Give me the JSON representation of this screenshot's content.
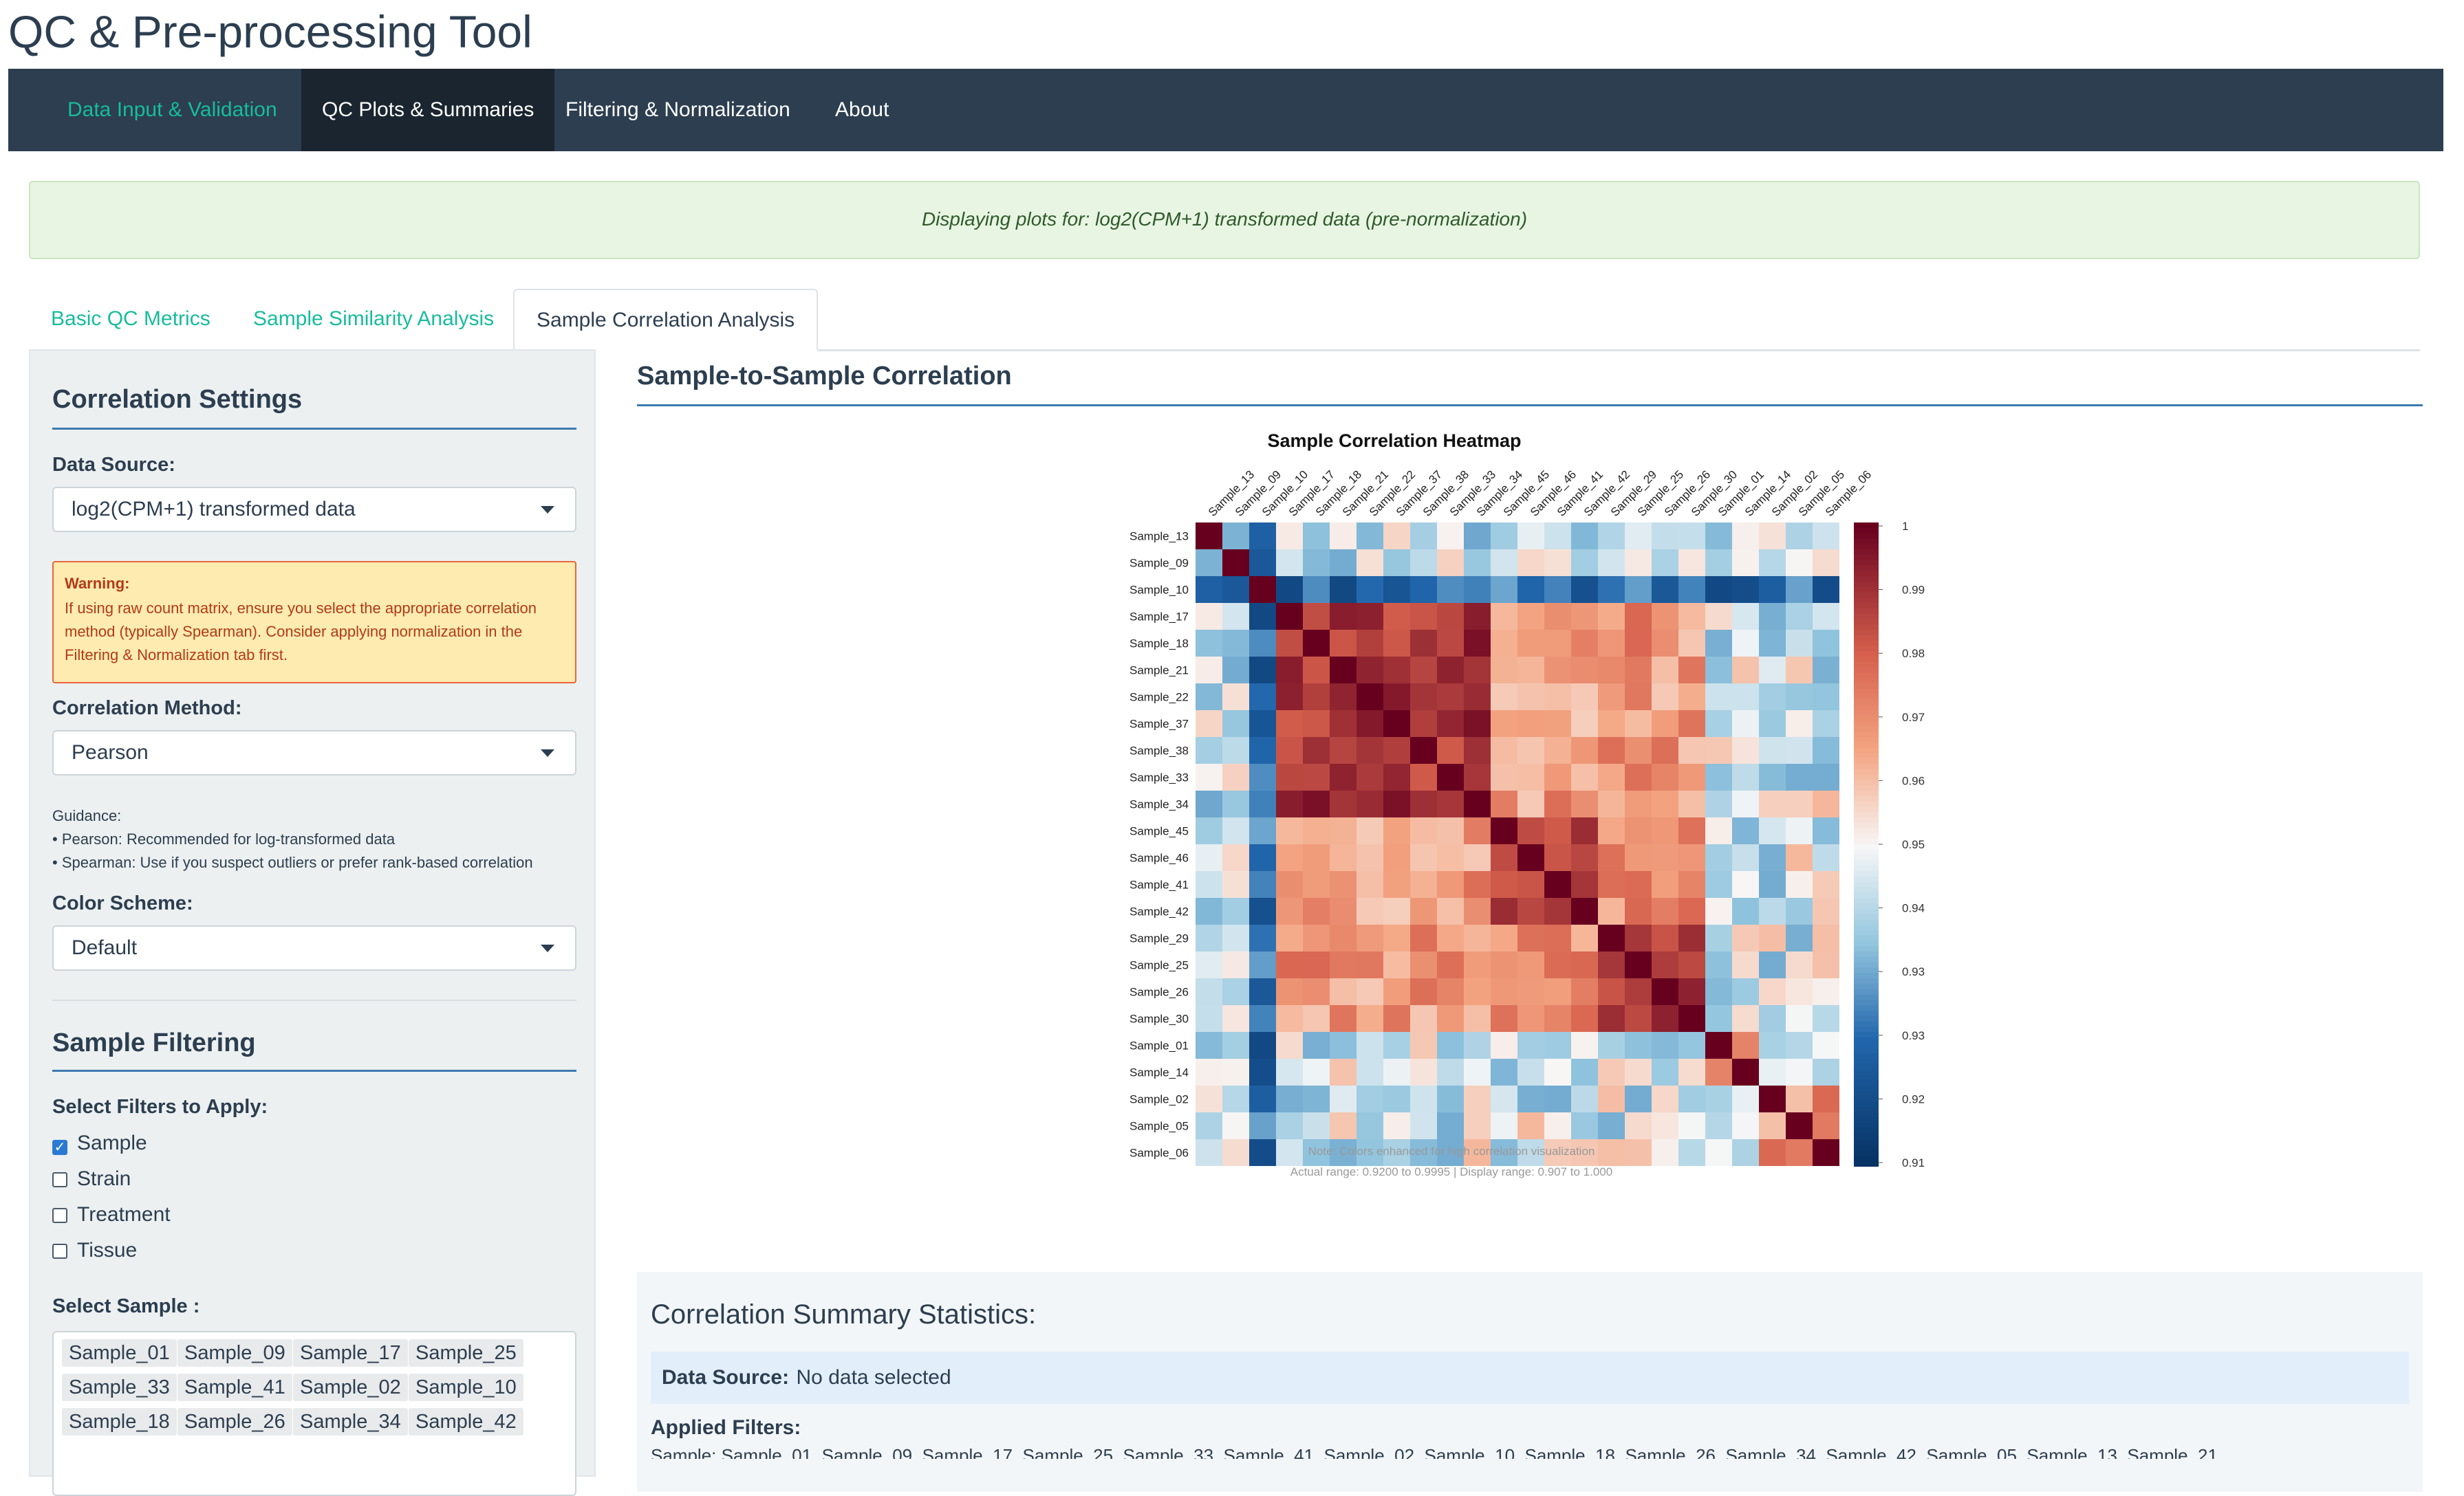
{
  "app": {
    "title": "QC & Pre-processing Tool"
  },
  "nav": {
    "items": [
      "Data Input & Validation",
      "QC Plots & Summaries",
      "Filtering & Normalization",
      "About"
    ]
  },
  "alert": {
    "text": "Displaying plots for: log2(CPM+1) transformed data (pre-normalization)"
  },
  "subtabs": {
    "items": [
      "Basic QC Metrics",
      "Sample Similarity Analysis",
      "Sample Correlation Analysis"
    ]
  },
  "sidebar": {
    "correlation_settings": {
      "title": "Correlation Settings",
      "data_source_label": "Data Source:",
      "data_source_value": "log2(CPM+1) transformed data",
      "warning_title": "Warning:",
      "warning_text": "If using raw count matrix, ensure you select the appropriate correlation method (typically Spearman). Consider applying normalization in the Filtering & Normalization tab first.",
      "method_label": "Correlation Method:",
      "method_value": "Pearson",
      "guidance_title": "Guidance:",
      "guidance_lines": [
        "• Pearson: Recommended for log-transformed data",
        "• Spearman: Use if you suspect outliers or prefer rank-based correlation"
      ],
      "color_label": "Color Scheme:",
      "color_value": "Default"
    },
    "sample_filtering": {
      "title": "Sample Filtering",
      "filters_label": "Select Filters to Apply:",
      "filters": [
        {
          "label": "Sample",
          "checked": true
        },
        {
          "label": "Strain",
          "checked": false
        },
        {
          "label": "Treatment",
          "checked": false
        },
        {
          "label": "Tissue",
          "checked": false
        }
      ],
      "select_sample_label": "Select Sample :",
      "samples": [
        "Sample_01",
        "Sample_09",
        "Sample_17",
        "Sample_25",
        "Sample_33",
        "Sample_41",
        "Sample_02",
        "Sample_10",
        "Sample_18",
        "Sample_26",
        "Sample_34",
        "Sample_42"
      ]
    }
  },
  "main": {
    "title": "Sample-to-Sample Correlation",
    "stats_title": "Correlation Summary Statistics:",
    "data_source_label": "Data Source:",
    "data_source_value": "No data selected",
    "applied_filters_label": "Applied Filters:",
    "applied_filters_value": "Sample: Sample_01, Sample_09, Sample_17, Sample_25, Sample_33, Sample_41, Sample_02, Sample_10, Sample_18, Sample_26, Sample_34, Sample_42, Sample_05, Sample_13, Sample_21"
  },
  "chart_data": {
    "type": "heatmap",
    "title": "Sample Correlation Heatmap",
    "samples": [
      "Sample_13",
      "Sample_09",
      "Sample_10",
      "Sample_17",
      "Sample_18",
      "Sample_21",
      "Sample_22",
      "Sample_37",
      "Sample_38",
      "Sample_33",
      "Sample_34",
      "Sample_45",
      "Sample_46",
      "Sample_41",
      "Sample_42",
      "Sample_29",
      "Sample_25",
      "Sample_26",
      "Sample_30",
      "Sample_01",
      "Sample_14",
      "Sample_02",
      "Sample_05",
      "Sample_06"
    ],
    "colorbar_ticks": [
      "1",
      "0.99",
      "0.98",
      "0.97",
      "0.96",
      "0.95",
      "0.94",
      "0.93",
      "0.93",
      "0.92",
      "0.91"
    ],
    "color_range": [
      0.907,
      1.0
    ],
    "note_lines": [
      "Note: Colors enhanced for high correlation visualization",
      "Actual range: 0.9200 to 0.9995 | Display range: 0.907 to 1.000"
    ],
    "colors": {
      "high": "#67001f",
      "mid": "#f7f7f7",
      "low": "#053061"
    }
  }
}
